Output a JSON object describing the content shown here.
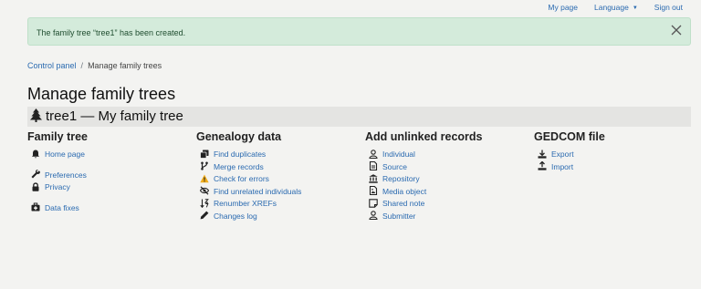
{
  "topnav": {
    "my_page": "My page",
    "language": "Language",
    "sign_out": "Sign out"
  },
  "alert": {
    "message": "The family tree “tree1” has been created."
  },
  "breadcrumb": {
    "control_panel": "Control panel",
    "separator": "/",
    "current": "Manage family trees"
  },
  "page": {
    "title": "Manage family trees",
    "tree_heading": "tree1 — My family tree"
  },
  "sections": {
    "family_tree": {
      "title": "Family tree",
      "home_page": "Home page",
      "preferences": "Preferences",
      "privacy": "Privacy",
      "data_fixes": "Data fixes"
    },
    "genealogy": {
      "title": "Genealogy data",
      "find_duplicates": "Find duplicates",
      "merge_records": "Merge records",
      "check_errors": "Check for errors",
      "find_unrelated": "Find unrelated individuals",
      "renumber_xrefs": "Renumber XREFs",
      "changes_log": "Changes log"
    },
    "unlinked": {
      "title": "Add unlinked records",
      "individual": "Individual",
      "source": "Source",
      "repository": "Repository",
      "media_object": "Media object",
      "shared_note": "Shared note",
      "submitter": "Submitter"
    },
    "gedcom": {
      "title": "GEDCOM file",
      "export": "Export",
      "import": "Import"
    }
  },
  "colors": {
    "link": "#2a6ab0",
    "alert_bg": "#d4ebdb",
    "warning": "#f0ad1c"
  }
}
